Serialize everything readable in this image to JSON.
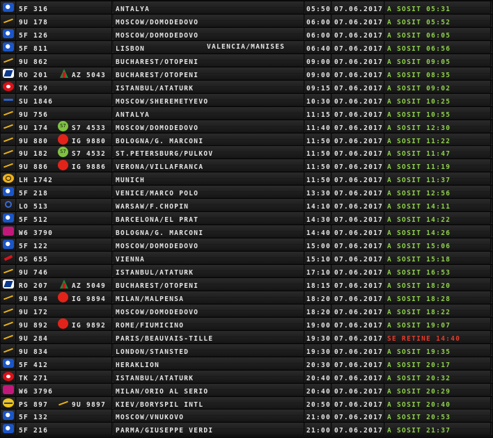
{
  "flights": [
    {
      "logo": "blue-swirl",
      "code": "5F  316",
      "share": "",
      "dest": "ANTALYA",
      "dest2": "",
      "time": "05:50",
      "date": "07.06.2017",
      "status": "A SOSIT 05:31",
      "status_color": "ok"
    },
    {
      "logo": "gold-wings",
      "code": "9U  178",
      "share": "",
      "dest": "MOSCOW/DOMODEDOVO",
      "dest2": "",
      "time": "06:00",
      "date": "07.06.2017",
      "status": "A SOSIT 05:52",
      "status_color": "ok"
    },
    {
      "logo": "blue-swirl",
      "code": "5F  126",
      "share": "",
      "dest": "MOSCOW/DOMODEDOVO",
      "dest2": "",
      "time": "06:00",
      "date": "07.06.2017",
      "status": "A SOSIT 06:05",
      "status_color": "ok"
    },
    {
      "logo": "blue-swirl",
      "code": "5F  811",
      "share": "",
      "dest": "LISBON",
      "dest2": "VALENCIA/MANISES",
      "time": "06:40",
      "date": "07.06.2017",
      "status": "A SOSIT 06:56",
      "status_color": "ok"
    },
    {
      "logo": "gold-wings",
      "code": "9U  862",
      "share": "",
      "dest": "BUCHAREST/OTOPENI",
      "dest2": "",
      "time": "09:00",
      "date": "07.06.2017",
      "status": "A SOSIT 09:05",
      "status_color": "ok"
    },
    {
      "logo": "tarom",
      "code": "RO  201",
      "share": "AZ 5043",
      "share_icon": "alitalia",
      "dest": "BUCHAREST/OTOPENI",
      "dest2": "",
      "time": "09:00",
      "date": "07.06.2017",
      "status": "A SOSIT 08:35",
      "status_color": "ok"
    },
    {
      "logo": "turkish",
      "code": "TK  269",
      "share": "",
      "dest": "ISTANBUL/ATATURK",
      "dest2": "",
      "time": "09:15",
      "date": "07.06.2017",
      "status": "A SOSIT 09:02",
      "status_color": "ok"
    },
    {
      "logo": "aeroflot",
      "code": "SU  1846",
      "share": "",
      "dest": "MOSCOW/SHEREMETYEVO",
      "dest2": "",
      "time": "10:30",
      "date": "07.06.2017",
      "status": "A SOSIT 10:25",
      "status_color": "ok"
    },
    {
      "logo": "gold-wings",
      "code": "9U  756",
      "share": "",
      "dest": "ANTALYA",
      "dest2": "",
      "time": "11:15",
      "date": "07.06.2017",
      "status": "A SOSIT 10:55",
      "status_color": "ok"
    },
    {
      "logo": "gold-wings",
      "code": "9U  174",
      "share": "S7 4533",
      "share_icon": "s7",
      "dest": "MOSCOW/DOMODEDOVO",
      "dest2": "",
      "time": "11:40",
      "date": "07.06.2017",
      "status": "A SOSIT 12:30",
      "status_color": "ok"
    },
    {
      "logo": "gold-wings",
      "code": "9U  880",
      "share": "IG 9880",
      "share_icon": "meridiana",
      "dest": "BOLOGNA/G. MARCONI",
      "dest2": "",
      "time": "11:50",
      "date": "07.06.2017",
      "status": "A SOSIT 11:22",
      "status_color": "ok"
    },
    {
      "logo": "gold-wings",
      "code": "9U  182",
      "share": "S7 4532",
      "share_icon": "s7",
      "dest": "ST.PETERSBURG/PULKOV",
      "dest2": "",
      "time": "11:50",
      "date": "07.06.2017",
      "status": "A SOSIT 11:47",
      "status_color": "ok"
    },
    {
      "logo": "gold-wings",
      "code": "9U  886",
      "share": "IG 9886",
      "share_icon": "meridiana",
      "dest": "VERONA/VILLAFRANCA",
      "dest2": "",
      "time": "11:50",
      "date": "07.06.2017",
      "status": "A SOSIT 11:19",
      "status_color": "ok"
    },
    {
      "logo": "lufthansa",
      "code": "LH  1742",
      "share": "",
      "dest": "MUNICH",
      "dest2": "",
      "time": "11:50",
      "date": "07.06.2017",
      "status": "A SOSIT 11:37",
      "status_color": "ok"
    },
    {
      "logo": "blue-swirl",
      "code": "5F  218",
      "share": "",
      "dest": "VENICE/MARCO POLO",
      "dest2": "",
      "time": "13:30",
      "date": "07.06.2017",
      "status": "A SOSIT 12:56",
      "status_color": "ok"
    },
    {
      "logo": "lot",
      "code": "LO  513",
      "share": "",
      "dest": "WARSAW/F.CHOPIN",
      "dest2": "",
      "time": "14:10",
      "date": "07.06.2017",
      "status": "A SOSIT 14:11",
      "status_color": "ok"
    },
    {
      "logo": "blue-swirl",
      "code": "5F  512",
      "share": "",
      "dest": "BARCELONA/EL PRAT",
      "dest2": "",
      "time": "14:30",
      "date": "07.06.2017",
      "status": "A SOSIT 14:22",
      "status_color": "ok"
    },
    {
      "logo": "wizz",
      "code": "W6  3790",
      "share": "",
      "dest": "BOLOGNA/G. MARCONI",
      "dest2": "",
      "time": "14:40",
      "date": "07.06.2017",
      "status": "A SOSIT 14:26",
      "status_color": "ok"
    },
    {
      "logo": "blue-swirl",
      "code": "5F  122",
      "share": "",
      "dest": "MOSCOW/DOMODEDOVO",
      "dest2": "",
      "time": "15:00",
      "date": "07.06.2017",
      "status": "A SOSIT 15:06",
      "status_color": "ok"
    },
    {
      "logo": "austrian",
      "code": "OS  655",
      "share": "",
      "dest": "VIENNA",
      "dest2": "",
      "time": "15:10",
      "date": "07.06.2017",
      "status": "A SOSIT 15:18",
      "status_color": "ok"
    },
    {
      "logo": "gold-wings",
      "code": "9U  746",
      "share": "",
      "dest": "ISTANBUL/ATATURK",
      "dest2": "",
      "time": "17:10",
      "date": "07.06.2017",
      "status": "A SOSIT 16:53",
      "status_color": "ok"
    },
    {
      "logo": "tarom",
      "code": "RO  207",
      "share": "AZ 5049",
      "share_icon": "alitalia",
      "dest": "BUCHAREST/OTOPENI",
      "dest2": "",
      "time": "18:15",
      "date": "07.06.2017",
      "status": "A SOSIT 18:20",
      "status_color": "ok"
    },
    {
      "logo": "gold-wings",
      "code": "9U  894",
      "share": "IG 9894",
      "share_icon": "meridiana",
      "dest": "MILAN/MALPENSA",
      "dest2": "",
      "time": "18:20",
      "date": "07.06.2017",
      "status": "A SOSIT 18:28",
      "status_color": "ok"
    },
    {
      "logo": "gold-wings",
      "code": "9U  172",
      "share": "",
      "dest": "MOSCOW/DOMODEDOVO",
      "dest2": "",
      "time": "18:20",
      "date": "07.06.2017",
      "status": "A SOSIT 18:22",
      "status_color": "ok"
    },
    {
      "logo": "gold-wings",
      "code": "9U  892",
      "share": "IG 9892",
      "share_icon": "meridiana",
      "dest": "ROME/FIUMICINO",
      "dest2": "",
      "time": "19:00",
      "date": "07.06.2017",
      "status": "A SOSIT 19:07",
      "status_color": "ok"
    },
    {
      "logo": "gold-wings",
      "code": "9U  284",
      "share": "",
      "dest": "PARIS/BEAUVAIS-TILLE",
      "dest2": "",
      "time": "19:30",
      "date": "07.06.2017",
      "status": "SE RETINE 14:40",
      "status_color": "late"
    },
    {
      "logo": "gold-wings",
      "code": "9U  834",
      "share": "",
      "dest": "LONDON/STANSTED",
      "dest2": "",
      "time": "19:30",
      "date": "07.06.2017",
      "status": "A SOSIT 19:35",
      "status_color": "ok"
    },
    {
      "logo": "blue-swirl",
      "code": "5F  412",
      "share": "",
      "dest": "HERAKLION",
      "dest2": "",
      "time": "20:30",
      "date": "07.06.2017",
      "status": "A SOSIT 20:17",
      "status_color": "ok"
    },
    {
      "logo": "turkish",
      "code": "TK  271",
      "share": "",
      "dest": "ISTANBUL/ATATURK",
      "dest2": "",
      "time": "20:40",
      "date": "07.06.2017",
      "status": "A SOSIT 20:32",
      "status_color": "ok"
    },
    {
      "logo": "wizz",
      "code": "W6  3796",
      "share": "",
      "dest": "MILAN/ORIO AL SERIO",
      "dest2": "",
      "time": "20:40",
      "date": "07.06.2017",
      "status": "A SOSIT 20:29",
      "status_color": "ok"
    },
    {
      "logo": "ps",
      "code": "PS  897",
      "share": "9U 9897",
      "share_icon": "gold-wings",
      "dest": "KIEV/BORYSPIL INTL",
      "dest2": "",
      "time": "20:50",
      "date": "07.06.2017",
      "status": "A SOSIT 20:40",
      "status_color": "ok"
    },
    {
      "logo": "blue-swirl",
      "code": "5F  132",
      "share": "",
      "dest": "MOSCOW/VNUKOVO",
      "dest2": "",
      "time": "21:00",
      "date": "07.06.2017",
      "status": "A SOSIT 20:53",
      "status_color": "ok"
    },
    {
      "logo": "blue-swirl",
      "code": "5F  216",
      "share": "",
      "dest": "PARMA/GIUSEPPE VERDI",
      "dest2": "",
      "time": "21:00",
      "date": "07.06.2017",
      "status": "A SOSIT 21:37",
      "status_color": "ok"
    }
  ],
  "colors": {
    "status_ok": "#8fd14b",
    "status_late": "#e83a2a",
    "text": "#e6e6e6",
    "board_bg": "#111111"
  },
  "share_labels": {
    "s7": "S7"
  }
}
